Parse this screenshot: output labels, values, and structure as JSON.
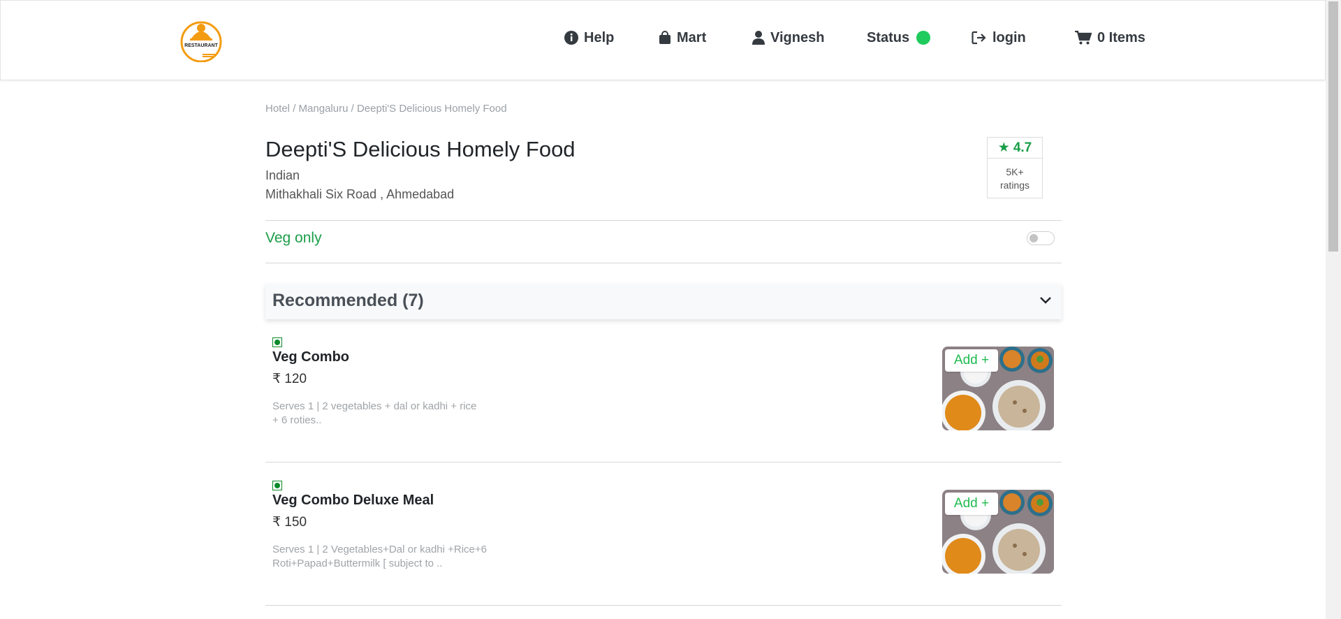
{
  "header": {
    "nav": {
      "help": "Help",
      "mart": "Mart",
      "user": "Vignesh",
      "status": "Status",
      "login": "login",
      "cart": "0 Items"
    },
    "status_color": "#1fcb5c",
    "logo_text": "RESTAURANT"
  },
  "breadcrumb": {
    "hotel": "Hotel",
    "city": "Mangaluru",
    "restaurant": "Deepti'S Delicious Homely Food",
    "separator": " / "
  },
  "restaurant": {
    "name": "Deepti'S Delicious Homely Food",
    "cuisine": "Indian",
    "address": "Mithakhali Six Road , Ahmedabad",
    "rating": "4.7",
    "ratings_count": "5K+",
    "ratings_label": "ratings"
  },
  "filters": {
    "veg_only_label": "Veg only",
    "veg_only_enabled": false
  },
  "section": {
    "title": "Recommended (7)"
  },
  "items": [
    {
      "name": "Veg Combo",
      "price": "₹ 120",
      "description": "Serves 1 | 2 vegetables + dal or kadhi + rice + 6 roties..",
      "add_label": "Add +"
    },
    {
      "name": "Veg Combo Deluxe Meal",
      "price": "₹ 150",
      "description": "Serves 1 | 2 Vegetables+Dal or kadhi +Rice+6 Roti+Papad+Buttermilk [ subject to ..",
      "add_label": "Add +"
    }
  ],
  "colors": {
    "brand_green": "#1a9e48",
    "add_green": "#1fbb4f",
    "logo_orange": "#f39c12"
  }
}
